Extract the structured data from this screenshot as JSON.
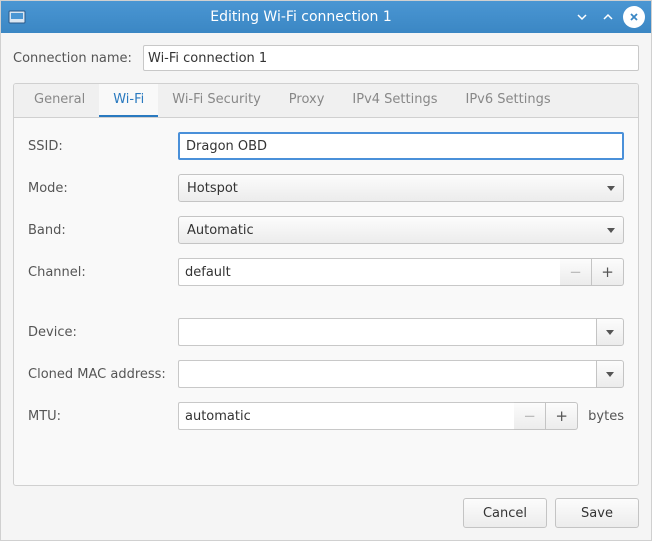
{
  "titlebar": {
    "title": "Editing Wi-Fi connection 1"
  },
  "connection_name": {
    "label": "Connection name:",
    "value": "Wi-Fi connection 1"
  },
  "tabs": {
    "general": "General",
    "wifi": "Wi-Fi",
    "wifi_security": "Wi-Fi Security",
    "proxy": "Proxy",
    "ipv4": "IPv4 Settings",
    "ipv6": "IPv6 Settings"
  },
  "wifi_page": {
    "ssid_label": "SSID:",
    "ssid_value": "Dragon OBD",
    "mode_label": "Mode:",
    "mode_value": "Hotspot",
    "band_label": "Band:",
    "band_value": "Automatic",
    "channel_label": "Channel:",
    "channel_value": "default",
    "device_label": "Device:",
    "device_value": "",
    "cloned_mac_label": "Cloned MAC address:",
    "cloned_mac_value": "",
    "mtu_label": "MTU:",
    "mtu_value": "automatic",
    "mtu_unit": "bytes"
  },
  "footer": {
    "cancel": "Cancel",
    "save": "Save"
  }
}
